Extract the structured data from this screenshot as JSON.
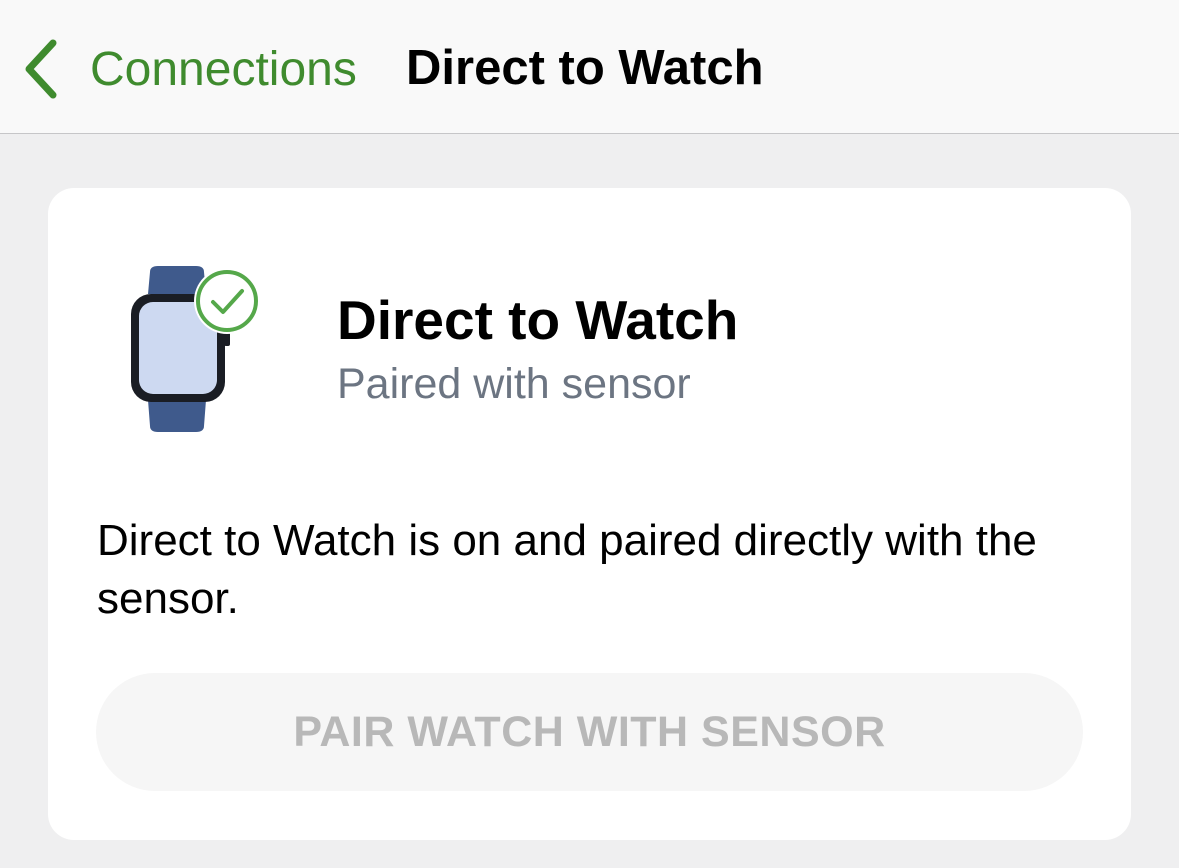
{
  "nav": {
    "back_label": "Connections",
    "title": "Direct to Watch"
  },
  "status": {
    "icon": "watch-paired-icon",
    "title": "Direct to Watch",
    "subtitle": "Paired with sensor"
  },
  "description": "Direct to Watch is on and paired directly with the sensor.",
  "pair_button": {
    "label": "PAIR WATCH WITH SENSOR",
    "enabled": false
  },
  "colors": {
    "accent": "#3f8b2e",
    "watch_band": "#3f5a8c",
    "watch_screen": "#cdd9f1"
  }
}
